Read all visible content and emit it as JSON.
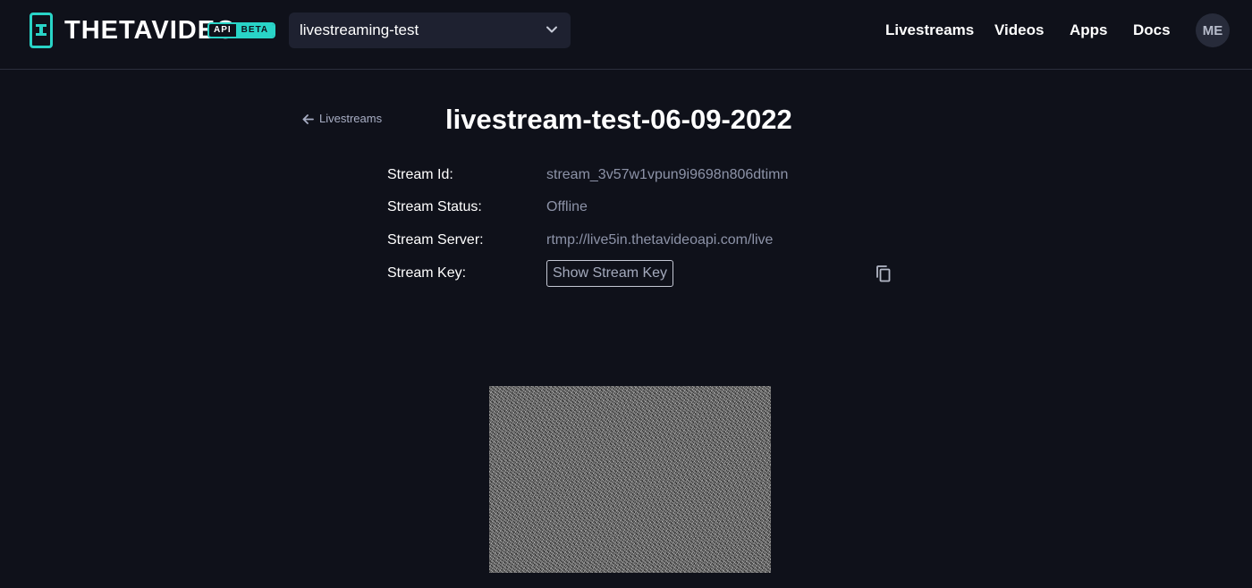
{
  "brand": {
    "logo_text": "THETAVIDEO",
    "badge_api": "API",
    "badge_beta": "BETA",
    "accent_color": "#29d4c7"
  },
  "project_select": {
    "selected": "livestreaming-test",
    "icon": "chevron-down-icon"
  },
  "nav": {
    "livestreams": "Livestreams",
    "videos": "Videos",
    "apps": "Apps",
    "docs": "Docs"
  },
  "user": {
    "initials": "ME"
  },
  "back_link": {
    "label": "Livestreams",
    "icon": "arrow-left-icon"
  },
  "page_title": "livestream-test-06-09-2022",
  "details": {
    "stream_id_label": "Stream Id:",
    "stream_id_value": "stream_3v57w1vpun9i9698n806dtimn",
    "status_label": "Stream Status:",
    "status_value": "Offline",
    "server_label": "Stream Server:",
    "server_value": "rtmp://live5in.thetavideoapi.com/live",
    "key_label": "Stream Key:",
    "show_key_button": "Show Stream Key",
    "copy_icon": "copy-icon"
  }
}
